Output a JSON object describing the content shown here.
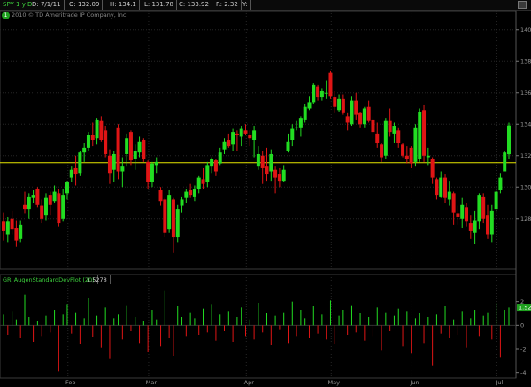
{
  "header": {
    "symbol": "SPY 1 y D",
    "date": "D: 7/1/11",
    "open": "O: 132.09",
    "high": "H: 134.1",
    "low": "L: 131.78",
    "close": "C: 133.92",
    "range": "R: 2.32",
    "y_label": "Y:"
  },
  "copyright": {
    "badge": "1",
    "text": "2010 © TD Ameritrade IP Company, Inc."
  },
  "study": {
    "name": "GR_AugenStandardDevPlot (20)",
    "value": "1.5278",
    "last_badge": "1.52"
  },
  "colors": {
    "up": "#22dd22",
    "down": "#e01515",
    "ref_line": "#e6e600",
    "grid": "#262626"
  },
  "chart_data": [
    {
      "type": "candlestick",
      "ylim": [
        125,
        141
      ],
      "yticks": [
        128,
        130,
        132,
        134,
        136,
        138,
        140
      ],
      "reference_line": 131.55,
      "x_labels": [
        "Feb",
        "Mar",
        "Apr",
        "May",
        "Jun",
        "Jul"
      ],
      "x_label_index": [
        16,
        35,
        58,
        78,
        97,
        117
      ],
      "ohlc": [
        [
          127.8,
          128.4,
          126.6,
          127.2
        ],
        [
          127.0,
          128.1,
          126.5,
          127.8
        ],
        [
          128.0,
          128.5,
          127.0,
          127.3
        ],
        [
          127.4,
          127.9,
          126.2,
          126.6
        ],
        [
          126.7,
          127.9,
          126.5,
          127.6
        ],
        [
          128.9,
          129.7,
          128.3,
          128.6
        ],
        [
          128.6,
          129.6,
          128.0,
          129.4
        ],
        [
          129.3,
          129.8,
          129.0,
          129.5
        ],
        [
          129.9,
          130.0,
          128.7,
          128.9
        ],
        [
          128.8,
          129.2,
          127.7,
          128.0
        ],
        [
          128.2,
          129.6,
          127.9,
          129.3
        ],
        [
          129.5,
          129.7,
          128.2,
          128.9
        ],
        [
          129.1,
          130.1,
          129.0,
          129.7
        ],
        [
          129.6,
          129.9,
          127.5,
          127.7
        ],
        [
          128.0,
          129.9,
          127.8,
          129.5
        ],
        [
          129.6,
          130.4,
          129.2,
          130.3
        ],
        [
          130.6,
          131.3,
          130.3,
          131.1
        ],
        [
          131.2,
          132.0,
          130.1,
          130.8
        ],
        [
          130.9,
          132.3,
          130.7,
          132.2
        ],
        [
          132.2,
          132.8,
          131.6,
          132.5
        ],
        [
          132.5,
          133.5,
          132.3,
          133.3
        ],
        [
          133.3,
          134.1,
          132.6,
          133.0
        ],
        [
          133.1,
          134.4,
          132.7,
          134.3
        ],
        [
          134.2,
          134.5,
          132.9,
          133.0
        ],
        [
          133.6,
          133.9,
          131.9,
          132.1
        ],
        [
          132.0,
          132.4,
          130.2,
          130.9
        ],
        [
          131.1,
          132.3,
          130.3,
          132.1
        ],
        [
          133.8,
          134.0,
          130.5,
          131.0
        ],
        [
          131.0,
          131.9,
          130.0,
          131.3
        ],
        [
          132.1,
          133.4,
          131.3,
          133.1
        ],
        [
          133.5,
          133.6,
          131.4,
          131.7
        ],
        [
          131.8,
          132.7,
          131.1,
          132.3
        ],
        [
          132.2,
          133.2,
          131.9,
          132.9
        ],
        [
          133.0,
          133.1,
          131.6,
          131.8
        ],
        [
          131.6,
          131.7,
          129.9,
          130.3
        ],
        [
          130.3,
          131.6,
          130.0,
          131.5
        ],
        [
          131.4,
          131.9,
          130.9,
          131.6
        ],
        [
          129.8,
          130.0,
          128.8,
          129.1
        ],
        [
          129.2,
          129.3,
          126.8,
          127.1
        ],
        [
          127.3,
          129.8,
          127.1,
          129.5
        ],
        [
          129.2,
          129.3,
          125.8,
          126.8
        ],
        [
          126.8,
          128.9,
          126.5,
          128.6
        ],
        [
          128.8,
          129.4,
          128.4,
          129.2
        ],
        [
          129.3,
          129.9,
          129.0,
          129.7
        ],
        [
          129.8,
          130.2,
          129.3,
          129.5
        ],
        [
          129.4,
          130.1,
          129.1,
          129.9
        ],
        [
          129.9,
          130.7,
          129.6,
          130.6
        ],
        [
          130.5,
          131.2,
          129.9,
          130.2
        ],
        [
          130.3,
          131.6,
          130.0,
          131.4
        ],
        [
          131.3,
          131.9,
          130.9,
          131.8
        ],
        [
          131.7,
          131.8,
          130.7,
          131.0
        ],
        [
          131.5,
          132.5,
          131.4,
          132.2
        ],
        [
          132.4,
          133.1,
          132.1,
          132.9
        ],
        [
          133.0,
          133.4,
          132.5,
          132.6
        ],
        [
          132.7,
          133.7,
          132.3,
          133.5
        ],
        [
          133.4,
          133.6,
          132.3,
          133.3
        ],
        [
          133.2,
          133.9,
          132.6,
          133.7
        ],
        [
          133.6,
          134.0,
          133.3,
          133.4
        ],
        [
          133.3,
          133.6,
          132.6,
          133.1
        ],
        [
          133.0,
          133.9,
          131.9,
          133.6
        ],
        [
          131.3,
          132.6,
          131.1,
          132.1
        ],
        [
          132.0,
          132.3,
          130.2,
          131.2
        ],
        [
          131.3,
          132.5,
          130.4,
          130.8
        ],
        [
          131.0,
          132.4,
          130.4,
          132.1
        ],
        [
          131.1,
          131.3,
          129.6,
          130.6
        ],
        [
          130.8,
          131.2,
          130.0,
          130.4
        ],
        [
          130.4,
          131.4,
          130.3,
          131.1
        ],
        [
          132.3,
          133.4,
          132.2,
          132.9
        ],
        [
          133.0,
          134.0,
          132.6,
          133.7
        ],
        [
          133.8,
          134.2,
          133.6,
          133.8
        ],
        [
          133.8,
          134.5,
          133.2,
          134.4
        ],
        [
          134.3,
          135.3,
          134.1,
          135.1
        ],
        [
          135.0,
          135.8,
          134.9,
          135.4
        ],
        [
          135.4,
          136.6,
          135.3,
          136.5
        ],
        [
          136.4,
          136.5,
          135.5,
          135.7
        ],
        [
          135.7,
          136.3,
          135.5,
          136.1
        ],
        [
          136.0,
          136.8,
          135.6,
          136.0
        ],
        [
          137.3,
          137.4,
          135.6,
          135.8
        ],
        [
          135.7,
          136.1,
          134.7,
          135.1
        ],
        [
          134.9,
          135.9,
          134.8,
          135.6
        ],
        [
          135.6,
          135.9,
          134.6,
          134.7
        ],
        [
          134.5,
          134.7,
          133.6,
          134.1
        ],
        [
          134.0,
          135.8,
          133.9,
          135.5
        ],
        [
          135.5,
          136.0,
          134.3,
          134.6
        ],
        [
          134.7,
          134.8,
          133.8,
          134.0
        ],
        [
          134.0,
          135.1,
          133.8,
          135.0
        ],
        [
          135.1,
          135.5,
          134.1,
          134.2
        ],
        [
          134.3,
          134.5,
          133.1,
          133.5
        ],
        [
          133.4,
          134.1,
          132.5,
          132.8
        ],
        [
          132.7,
          132.8,
          131.6,
          131.9
        ],
        [
          132.0,
          134.4,
          131.8,
          134.2
        ],
        [
          134.2,
          135.0,
          133.2,
          133.5
        ],
        [
          133.4,
          134.1,
          132.8,
          133.9
        ],
        [
          133.6,
          133.8,
          132.5,
          132.8
        ],
        [
          132.7,
          132.8,
          131.9,
          132.0
        ],
        [
          132.0,
          132.6,
          131.5,
          131.8
        ],
        [
          132.5,
          132.6,
          131.2,
          131.5
        ],
        [
          131.6,
          134.0,
          131.3,
          133.8
        ],
        [
          131.8,
          135.0,
          131.6,
          134.8
        ],
        [
          134.9,
          135.2,
          131.6,
          132.0
        ],
        [
          131.9,
          132.5,
          131.4,
          132.0
        ],
        [
          131.8,
          131.9,
          130.2,
          130.6
        ],
        [
          130.5,
          130.6,
          129.2,
          129.5
        ],
        [
          129.4,
          131.0,
          129.3,
          130.6
        ],
        [
          130.6,
          130.8,
          129.0,
          129.3
        ],
        [
          129.2,
          130.4,
          128.8,
          129.7
        ],
        [
          129.6,
          129.7,
          127.6,
          128.4
        ],
        [
          128.3,
          128.8,
          127.6,
          128.1
        ],
        [
          128.0,
          129.3,
          127.4,
          128.9
        ],
        [
          128.7,
          129.0,
          127.5,
          127.8
        ],
        [
          127.7,
          128.2,
          126.7,
          127.2
        ],
        [
          127.1,
          128.5,
          126.4,
          127.9
        ],
        [
          127.8,
          129.6,
          127.3,
          129.5
        ],
        [
          129.4,
          129.6,
          127.7,
          128.0
        ],
        [
          128.2,
          128.9,
          126.7,
          127.0
        ],
        [
          127.0,
          128.9,
          126.5,
          128.5
        ],
        [
          128.6,
          130.0,
          128.3,
          129.7
        ],
        [
          129.8,
          130.9,
          129.6,
          130.6
        ],
        [
          131.0,
          132.3,
          131.0,
          132.2
        ],
        [
          132.09,
          134.1,
          131.78,
          133.92
        ]
      ]
    },
    {
      "type": "bar",
      "name": "GR_AugenStandardDevPlot (20)",
      "ylim": [
        -4.4,
        3.4
      ],
      "yticks": [
        -4,
        -2,
        0,
        2
      ],
      "values": [
        0.9,
        -0.8,
        1.2,
        0.5,
        -1.1,
        2.6,
        0.7,
        -1.4,
        0.4,
        -0.9,
        0.8,
        -0.6,
        1.3,
        -3.9,
        0.9,
        1.8,
        -0.7,
        1.1,
        -1.6,
        0.6,
        2.3,
        -1.0,
        0.8,
        -1.9,
        1.5,
        -2.8,
        0.6,
        0.9,
        -1.2,
        1.7,
        -0.5,
        0.7,
        -1.5,
        0.4,
        -2.3,
        1.3,
        0.5,
        -1.8,
        2.9,
        -1.1,
        -2.6,
        1.6,
        0.7,
        -0.9,
        1.1,
        0.6,
        -0.8,
        1.4,
        -0.6,
        1.8,
        -1.3,
        0.9,
        -0.5,
        1.2,
        -1.4,
        0.7,
        1.5,
        -0.9,
        0.5,
        -1.2,
        1.9,
        -0.6,
        1.0,
        -1.7,
        0.8,
        -0.4,
        1.1,
        -1.5,
        2.0,
        -0.9,
        1.3,
        0.6,
        -1.1,
        1.6,
        -0.7,
        0.9,
        -1.2,
        2.1,
        -1.6,
        0.8,
        1.3,
        -0.8,
        1.7,
        -0.6,
        1.0,
        -1.3,
        0.7,
        -0.9,
        1.5,
        -2.1,
        1.1,
        -0.5,
        0.8,
        1.4,
        -1.8,
        1.2,
        -2.4,
        0.6,
        1.0,
        -1.5,
        0.7,
        -3.4,
        0.9,
        -0.7,
        1.6,
        -1.1,
        0.5,
        -0.8,
        1.2,
        -1.9,
        0.6,
        1.3,
        -0.9,
        0.8,
        1.1,
        -1.2,
        1.9,
        -2.7,
        1.3,
        1.5
      ]
    }
  ]
}
